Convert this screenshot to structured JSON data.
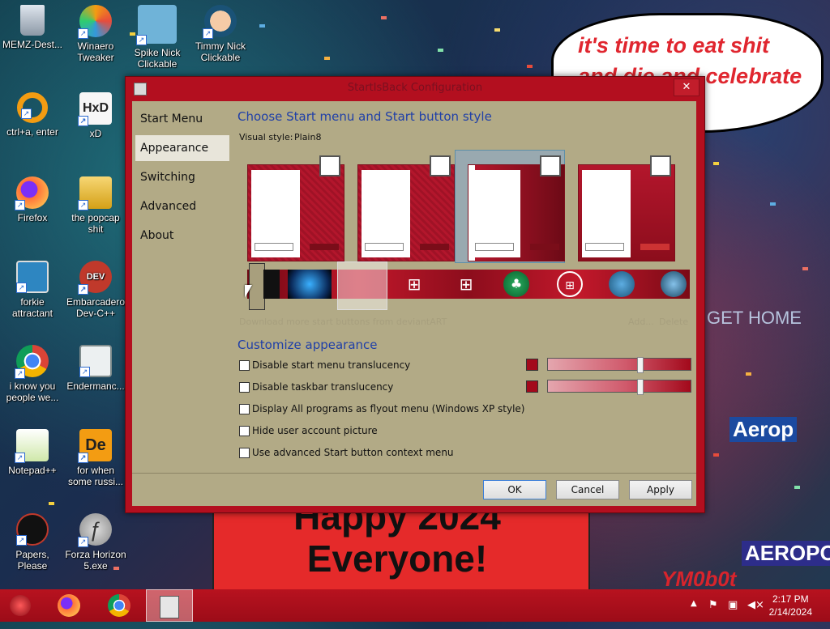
{
  "desktop": {
    "icons": [
      {
        "label": "MEMZ-Dest...",
        "icon": "recycle-bin-icon"
      },
      {
        "label": "Winaero Tweaker",
        "icon": "winaero-icon"
      },
      {
        "label": "Spike Nick Clickable",
        "icon": "spike-icon"
      },
      {
        "label": "Timmy Nick Clickable",
        "icon": "timmy-icon"
      },
      {
        "label": "ctrl+a, enter",
        "icon": "ring-icon"
      },
      {
        "label": "xD",
        "icon": "hxd-icon"
      },
      {
        "label": "Firefox",
        "icon": "firefox-icon"
      },
      {
        "label": "the popcap shit",
        "icon": "folder-icon"
      },
      {
        "label": "forkie attractant",
        "icon": "computer-icon"
      },
      {
        "label": "Embarcadero Dev-C++",
        "icon": "devcpp-icon"
      },
      {
        "label": "i know you people we...",
        "icon": "chrome-icon"
      },
      {
        "label": "Endermanc...",
        "icon": "window-icon"
      },
      {
        "label": "Notepad++",
        "icon": "notepadpp-icon"
      },
      {
        "label": "for when some russi...",
        "icon": "de-icon"
      },
      {
        "label": "Papers, Please",
        "icon": "papers-icon"
      },
      {
        "label": "Forza Horizon 5.exe",
        "icon": "flash-icon"
      }
    ],
    "bubble_text": "it's time to eat shit and die and celebrate",
    "poster_text": "Happy 2024 Everyone!",
    "watermark": "YM0b0t",
    "city_text_1": "GET HOME",
    "city_text_2": "Aerop",
    "city_text_3": "AEROPOS"
  },
  "window": {
    "title": "StartIsBack Configuration",
    "close_label": "✕",
    "sidebar": [
      "Start Menu",
      "Appearance",
      "Switching",
      "Advanced",
      "About"
    ],
    "selected_sidebar": "Appearance",
    "section1_heading": "Choose Start menu and Start button style",
    "visual_style_label": "Visual style:",
    "visual_style_value": "Plain8",
    "download_link": "Download more start buttons from deviantART",
    "add_link": "Add...",
    "delete_link": "Delete",
    "section2_heading": "Customize appearance",
    "options": [
      {
        "label": "Disable start menu translucency",
        "checked": false
      },
      {
        "label": "Disable taskbar translucency",
        "checked": false
      },
      {
        "label": "Display All programs as flyout menu (Windows XP style)",
        "checked": false
      },
      {
        "label": "Hide user account picture",
        "checked": false
      },
      {
        "label": "Use advanced Start button context menu",
        "checked": false
      }
    ],
    "buttons": {
      "ok": "OK",
      "cancel": "Cancel",
      "apply": "Apply"
    },
    "accent_color": "#a3091b",
    "selected_preview": 2
  },
  "taskbar": {
    "time": "2:17 PM",
    "date": "2/14/2024"
  }
}
